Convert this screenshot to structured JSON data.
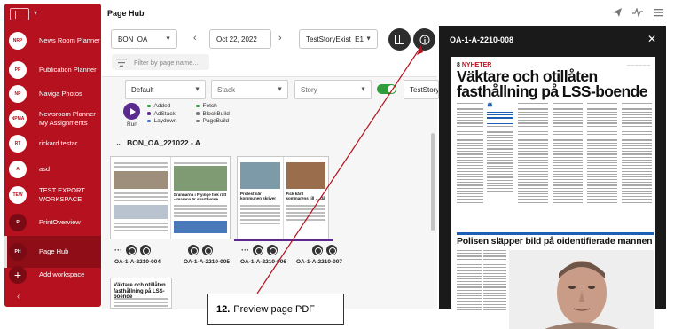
{
  "app": {
    "title": "Page Hub"
  },
  "sidebar": {
    "items": [
      {
        "abbr": "NRP",
        "label": "News Room Planner"
      },
      {
        "abbr": "PP",
        "label": "Publication Planner"
      },
      {
        "abbr": "NP",
        "label": "Naviga Photos"
      },
      {
        "abbr": "NPMA",
        "label": "Newsroom Planner My Assignments"
      },
      {
        "abbr": "RT",
        "label": "rickard testar"
      },
      {
        "abbr": "A",
        "label": "asd"
      },
      {
        "abbr": "TEW",
        "label": "TEST EXPORT WORKSPACE"
      },
      {
        "abbr": "P",
        "label": "PrintOverview"
      },
      {
        "abbr": "PH",
        "label": "Page Hub"
      }
    ],
    "add_label": "Add workspace",
    "add_icon": "+",
    "collapse_icon": "‹"
  },
  "toolbar": {
    "publication": "BON_OA",
    "date": "Oct 22, 2022",
    "edition": "TestStoryExist_E1",
    "filter_placeholder": "Filter by page name..."
  },
  "filters": {
    "default": "Default",
    "stack": "Stack",
    "story": "Story",
    "teststory": "TestStory"
  },
  "run": {
    "label": "Run"
  },
  "legend": {
    "col1": [
      "Added",
      "AdStack",
      "Laydown"
    ],
    "col2": [
      "Fetch",
      "BlockBuild",
      "PageBuild"
    ],
    "colors": [
      "#2e9d3a",
      "#5b2a8e",
      "#3a6fd8",
      "#2e9d3a",
      "#777777",
      "#777777"
    ]
  },
  "section": {
    "title": "BON_OA_221022 - A"
  },
  "pages": [
    {
      "id": "OA-1-A-2210-004"
    },
    {
      "id": "OA-1-A-2210-005"
    },
    {
      "id": "OA-1-A-2210-006"
    },
    {
      "id": "OA-1-A-2210-007"
    }
  ],
  "thumb_captions": {
    "p005": "Grannarna i Flyinge fick rätt – marana är svartbygge",
    "p006": "Protest när kommunen skriver flygplatsens under skoterga",
    "p007": "Fick kärlt sommarens till … då tätasten"
  },
  "callout": {
    "number": "12.",
    "text": "Preview page PDF"
  },
  "preview": {
    "title": "OA-1-A-2210-008",
    "close_icon": "✕",
    "section_number": "8",
    "section_name": "NYHETER",
    "headline": "Väktare och otillåten fasthållning på LSS-boende",
    "headline2": "Polisen släpper bild på oidentifierade mannen",
    "thumb_headline": "Väktare och otillåten fasthållning på LSS-boende"
  },
  "icons": {
    "header": [
      "send-icon",
      "activity-icon",
      "menu-icon"
    ],
    "layout": "layout-toggle-icon",
    "info": "info-icon"
  }
}
